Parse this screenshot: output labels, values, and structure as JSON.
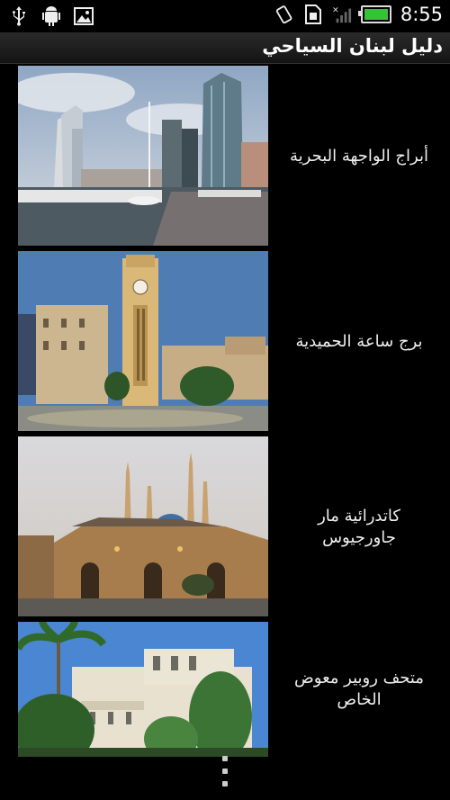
{
  "status_bar": {
    "time": "8:55",
    "icons": [
      "usb-icon",
      "android-debug-icon",
      "image-icon",
      "rotate-icon",
      "sim-icon",
      "signal-icon",
      "battery-icon"
    ]
  },
  "app": {
    "title": "دليل لبنان السياحي"
  },
  "items": [
    {
      "label": "أبراج الواجهة البحرية"
    },
    {
      "label": "برج ساعة الحميدية"
    },
    {
      "label": "كاتدرائية مار جاورجيوس"
    },
    {
      "label": "متحف روبير معوض الخاص"
    }
  ],
  "colors": {
    "background": "#000000",
    "battery": "#36c236"
  }
}
